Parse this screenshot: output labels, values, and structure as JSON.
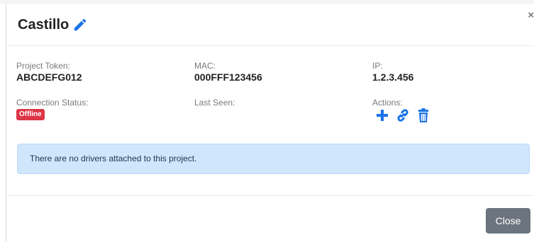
{
  "modal": {
    "title": "Castillo",
    "close_symbol": "×",
    "edit_icon": "pencil-icon"
  },
  "details": {
    "project_token": {
      "label": "Project Token:",
      "value": "ABCDEFG012"
    },
    "mac": {
      "label": "MAC:",
      "value": "000FFF123456"
    },
    "ip": {
      "label": "IP:",
      "value": "1.2.3.456"
    },
    "connection_status": {
      "label": "Connection Status:",
      "badge": "Offline",
      "badge_color": "#dc3545"
    },
    "last_seen": {
      "label": "Last Seen:",
      "value": ""
    },
    "actions": {
      "label": "Actions:",
      "icons": [
        "plus-icon",
        "link-icon",
        "trash-icon"
      ],
      "icon_color": "#1a73e8"
    }
  },
  "alert": {
    "message": "There are no drivers attached to this project.",
    "background": "#cfe6fb"
  },
  "footer": {
    "close_label": "Close",
    "button_color": "#6c757d"
  }
}
